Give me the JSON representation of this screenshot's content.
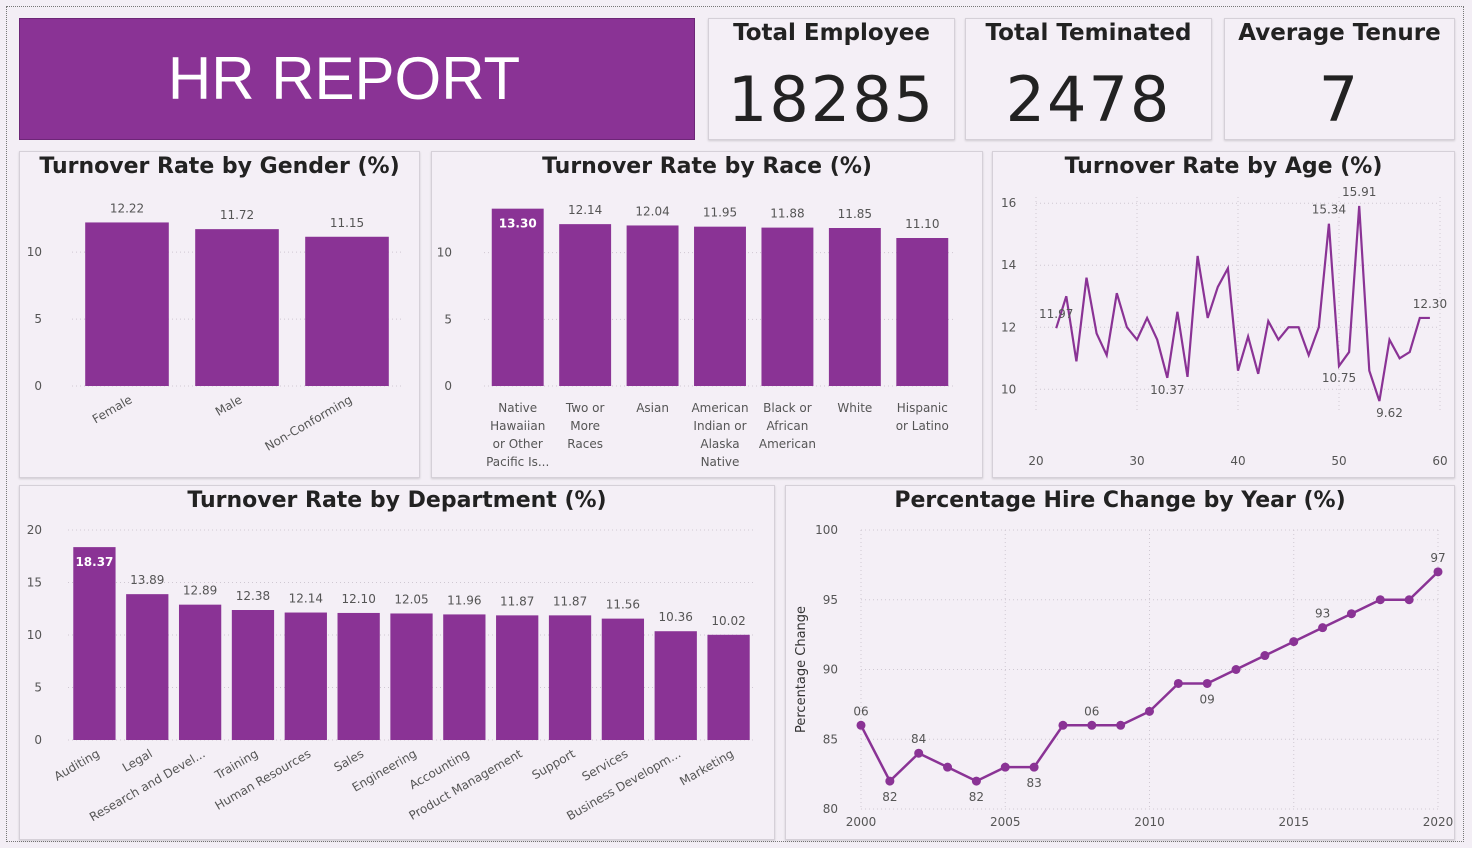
{
  "header": {
    "title": "HR REPORT"
  },
  "kpis": [
    {
      "label": "Total Employee",
      "value": "18285"
    },
    {
      "label": "Total Teminated",
      "value": "2478"
    },
    {
      "label": "Average Tenure",
      "value": "7"
    }
  ],
  "colors": {
    "bar": "#8a3395",
    "header": "#8a3395",
    "panel": "#f4eff6"
  },
  "chart_data": [
    {
      "id": "gender",
      "type": "bar",
      "title": "Turnover Rate by Gender (%)",
      "categories": [
        "Female",
        "Male",
        "Non-Conforming"
      ],
      "values": [
        12.22,
        11.72,
        11.15
      ],
      "labels": [
        "12.22",
        "11.72",
        "11.15"
      ],
      "yticks": [
        0,
        5,
        10
      ],
      "ylim": [
        0,
        13
      ],
      "grid": true
    },
    {
      "id": "race",
      "type": "bar",
      "title": "Turnover Rate by Race (%)",
      "categories": [
        "Native Hawaiian or Other Pacific Is...",
        "Two or More Races",
        "Asian",
        "American Indian or Alaska Native",
        "Black or African American",
        "White",
        "Hispanic or Latino"
      ],
      "category_lines": [
        [
          "Native",
          "Hawaiian",
          "or Other",
          "Pacific Is..."
        ],
        [
          "Two or",
          "More",
          "Races"
        ],
        [
          "Asian"
        ],
        [
          "American",
          "Indian or",
          "Alaska",
          "Native"
        ],
        [
          "Black or",
          "African",
          "American"
        ],
        [
          "White"
        ],
        [
          "Hispanic",
          "or Latino"
        ]
      ],
      "values": [
        13.3,
        12.14,
        12.04,
        11.95,
        11.88,
        11.85,
        11.1
      ],
      "labels": [
        "13.30",
        "12.14",
        "12.04",
        "11.95",
        "11.88",
        "11.85",
        "11.10"
      ],
      "yticks": [
        0,
        5,
        10
      ],
      "ylim": [
        0,
        13.5
      ],
      "grid": true
    },
    {
      "id": "age",
      "type": "line",
      "title": "Turnover Rate by Age (%)",
      "x": [
        22,
        23,
        24,
        25,
        26,
        27,
        28,
        29,
        30,
        31,
        32,
        33,
        34,
        35,
        36,
        37,
        38,
        39,
        40,
        41,
        42,
        43,
        44,
        45,
        46,
        47,
        48,
        49,
        50,
        51,
        52,
        53,
        54,
        55,
        56,
        57,
        58,
        59
      ],
      "values": [
        11.97,
        13.0,
        10.9,
        13.6,
        11.8,
        11.1,
        13.1,
        12.0,
        11.6,
        12.3,
        11.6,
        10.37,
        12.5,
        10.4,
        14.3,
        12.3,
        13.3,
        13.9,
        10.6,
        11.7,
        10.5,
        12.2,
        11.6,
        12.0,
        12.0,
        11.1,
        12.0,
        15.34,
        10.75,
        11.2,
        15.91,
        10.6,
        9.62,
        11.6,
        11.0,
        11.2,
        12.3,
        12.3
      ],
      "point_labels": [
        {
          "x": 22,
          "y": 11.97,
          "text": "11.97"
        },
        {
          "x": 33,
          "y": 10.37,
          "text": "10.37"
        },
        {
          "x": 49,
          "y": 15.34,
          "text": "15.34"
        },
        {
          "x": 50,
          "y": 10.75,
          "text": "10.75"
        },
        {
          "x": 52,
          "y": 15.91,
          "text": "15.91"
        },
        {
          "x": 55,
          "y": 9.62,
          "text": "9.62"
        },
        {
          "x": 59,
          "y": 12.3,
          "text": "12.30"
        }
      ],
      "xticks": [
        20,
        30,
        40,
        50,
        60
      ],
      "yticks": [
        10,
        12,
        14,
        16
      ],
      "xlim": [
        20,
        60
      ],
      "ylim": [
        9.3,
        16.2
      ],
      "grid": true
    },
    {
      "id": "department",
      "type": "bar",
      "title": "Turnover Rate by Department (%)",
      "categories": [
        "Auditing",
        "Legal",
        "Research and Devel...",
        "Training",
        "Human Resources",
        "Sales",
        "Engineering",
        "Accounting",
        "Product Management",
        "Support",
        "Services",
        "Business Developm...",
        "Marketing"
      ],
      "values": [
        18.37,
        13.89,
        12.89,
        12.38,
        12.14,
        12.1,
        12.05,
        11.96,
        11.87,
        11.87,
        11.56,
        10.36,
        10.02
      ],
      "labels": [
        "18.37",
        "13.89",
        "12.89",
        "12.38",
        "12.14",
        "12.10",
        "12.05",
        "11.96",
        "11.87",
        "11.87",
        "11.56",
        "10.36",
        "10.02"
      ],
      "yticks": [
        0,
        5,
        10,
        15,
        20
      ],
      "ylim": [
        0,
        20
      ],
      "grid": true
    },
    {
      "id": "hire",
      "type": "line",
      "title": "Percentage Hire Change by Year (%)",
      "ylabel": "Percentage Change",
      "x": [
        2000,
        2001,
        2002,
        2003,
        2004,
        2005,
        2006,
        2007,
        2008,
        2009,
        2010,
        2011,
        2012,
        2013,
        2014,
        2015,
        2016,
        2017,
        2018,
        2019,
        2020
      ],
      "values": [
        86,
        82,
        84,
        83,
        82,
        83,
        83,
        86,
        86,
        86,
        87,
        89,
        89,
        90,
        91,
        92,
        93,
        94,
        95,
        95,
        97
      ],
      "point_labels": [
        {
          "x": 2000,
          "y": 86,
          "text": "06",
          "pos": "above"
        },
        {
          "x": 2001,
          "y": 82,
          "text": "82",
          "pos": "below"
        },
        {
          "x": 2002,
          "y": 84,
          "text": "84",
          "pos": "above"
        },
        {
          "x": 2004,
          "y": 82,
          "text": "82",
          "pos": "below"
        },
        {
          "x": 2006,
          "y": 83,
          "text": "83",
          "pos": "below"
        },
        {
          "x": 2008,
          "y": 86,
          "text": "06",
          "pos": "above"
        },
        {
          "x": 2012,
          "y": 89,
          "text": "09",
          "pos": "below"
        },
        {
          "x": 2016,
          "y": 93,
          "text": "93",
          "pos": "above"
        },
        {
          "x": 2020,
          "y": 97,
          "text": "97",
          "pos": "above"
        }
      ],
      "xticks": [
        2000,
        2005,
        2010,
        2015,
        2020
      ],
      "yticks": [
        80,
        85,
        90,
        95,
        100
      ],
      "xlim": [
        2000,
        2020
      ],
      "ylim": [
        80,
        100
      ],
      "grid": true
    }
  ]
}
